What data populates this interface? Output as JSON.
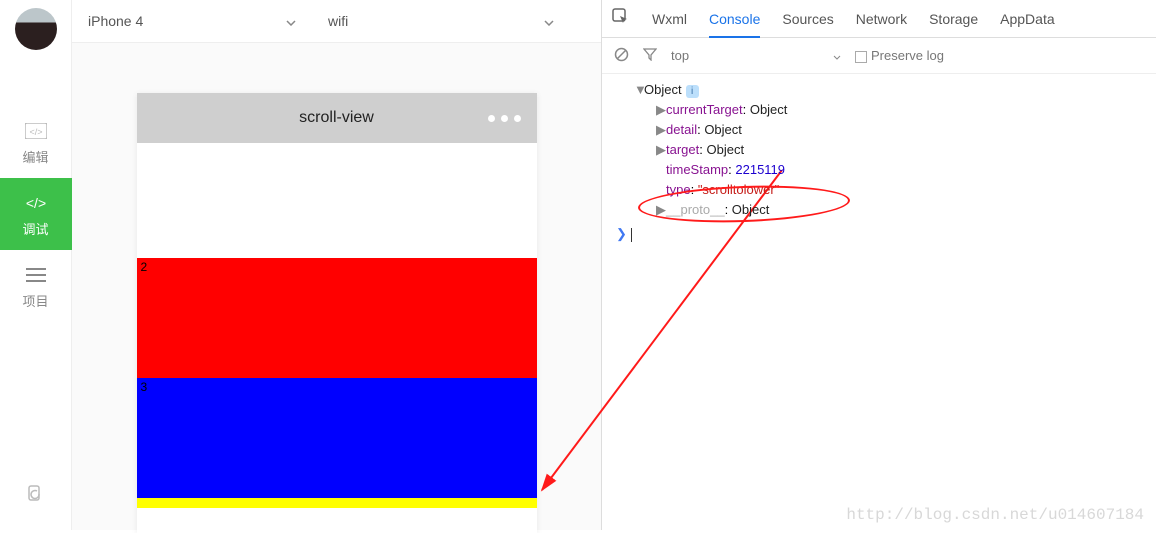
{
  "sidebar": {
    "avatar": "tree-avatar",
    "items": [
      {
        "icon": "code-brackets-icon",
        "label": "编辑"
      },
      {
        "icon": "debug-icon",
        "label": "调试"
      },
      {
        "icon": "hamburger-icon",
        "label": "项目"
      }
    ],
    "bottom_icon": "sync-icon"
  },
  "topbar": {
    "device": "iPhone 4",
    "network": "wifi"
  },
  "simulator": {
    "title": "scroll-view",
    "segments": [
      {
        "n": "2",
        "color": "red"
      },
      {
        "n": "3",
        "color": "blue"
      }
    ]
  },
  "devtools": {
    "tabs": [
      "Wxml",
      "Console",
      "Sources",
      "Network",
      "Storage",
      "AppData"
    ],
    "active_tab": "Console",
    "context": "top",
    "preserve_label": "Preserve log",
    "console": {
      "root": "Object",
      "props": [
        {
          "key": "currentTarget",
          "val": "Object",
          "kind": "obj"
        },
        {
          "key": "detail",
          "val": "Object",
          "kind": "obj"
        },
        {
          "key": "target",
          "val": "Object",
          "kind": "obj"
        },
        {
          "key": "timeStamp",
          "val": "2215119",
          "kind": "num"
        },
        {
          "key": "type",
          "val": "\"scrolltolower\"",
          "kind": "str"
        },
        {
          "key": "__proto__",
          "val": "Object",
          "kind": "dim"
        }
      ]
    }
  },
  "watermark": "http://blog.csdn.net/u014607184"
}
